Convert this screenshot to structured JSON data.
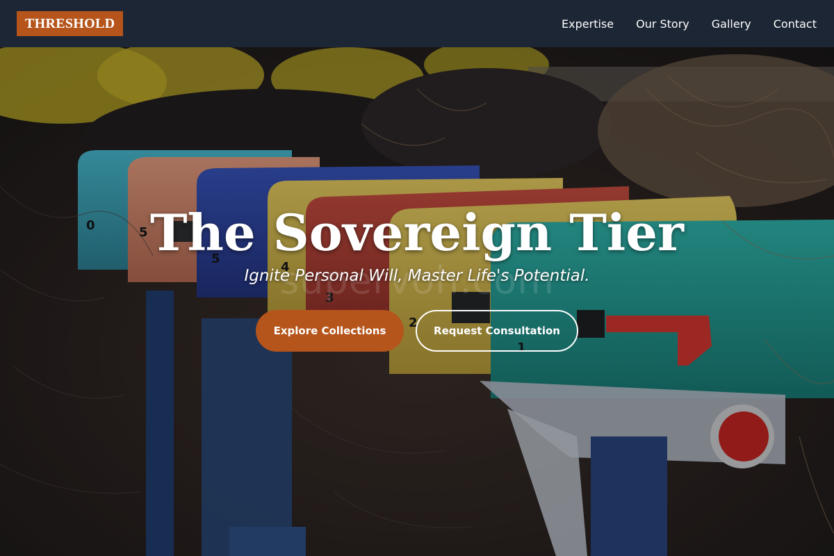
{
  "brand": {
    "name": "THRESHOLD",
    "accent": "#b5541b"
  },
  "nav": {
    "items": [
      {
        "label": "Expertise"
      },
      {
        "label": "Our Story"
      },
      {
        "label": "Gallery"
      },
      {
        "label": "Contact"
      }
    ]
  },
  "hero": {
    "title": "The Sovereign Tier",
    "subtitle": "Ignite Personal Will, Master Life's Potential.",
    "watermark": "supervoh.com",
    "primary_button": "Explore Collections",
    "secondary_button": "Request Consultation",
    "mailbox_numbers": [
      "0",
      "5",
      "5",
      "4",
      "3",
      "2",
      "1"
    ]
  }
}
